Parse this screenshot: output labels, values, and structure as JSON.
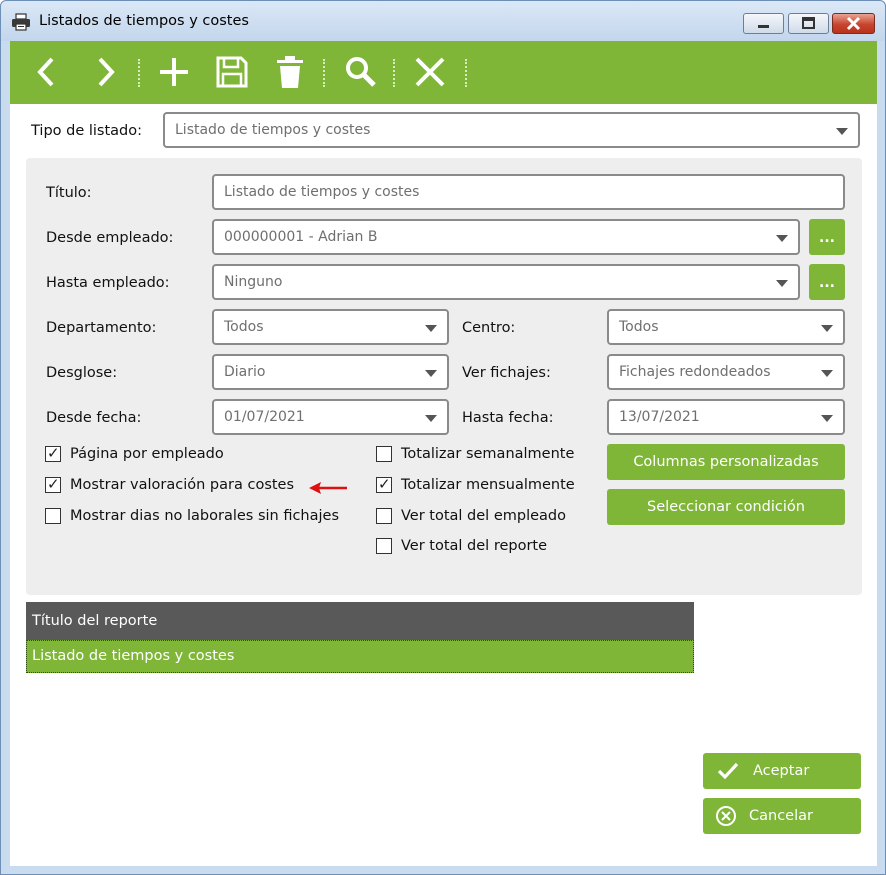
{
  "window": {
    "title": "Listados de tiempos y costes",
    "icon": "printer-icon",
    "controls": [
      "minimize-icon",
      "maximize-icon",
      "close-icon"
    ]
  },
  "colors": {
    "accent_green": "#7fb637",
    "report_header": "#595959",
    "arrow_red": "#e01010"
  },
  "toolbar": {
    "buttons": [
      {
        "name": "previous",
        "icon": "chevron-left-icon"
      },
      {
        "name": "next",
        "icon": "chevron-right-icon"
      },
      {
        "name": "add",
        "icon": "plus-icon"
      },
      {
        "name": "save",
        "icon": "floppy-disk-icon"
      },
      {
        "name": "delete",
        "icon": "trash-icon"
      },
      {
        "name": "search",
        "icon": "magnifier-icon"
      },
      {
        "name": "close",
        "icon": "x-icon"
      }
    ]
  },
  "tipo_listado": {
    "label": "Tipo de listado:",
    "value": "Listado de tiempos y costes"
  },
  "form": {
    "titulo": {
      "label": "Título:",
      "value": "Listado de tiempos y costes"
    },
    "desde_empleado": {
      "label": "Desde empleado:",
      "value": "000000001 - Adrian B",
      "button": "..."
    },
    "hasta_empleado": {
      "label": "Hasta empleado:",
      "value": "Ninguno",
      "button": "..."
    },
    "departamento": {
      "label": "Departamento:",
      "value": "Todos"
    },
    "centro": {
      "label": "Centro:",
      "value": "Todos"
    },
    "desglose": {
      "label": "Desglose:",
      "value": "Diario"
    },
    "ver_fichajes": {
      "label": "Ver fichajes:",
      "value": "Fichajes redondeados"
    },
    "desde_fecha": {
      "label": "Desde fecha:",
      "value": "01/07/2021"
    },
    "hasta_fecha": {
      "label": "Hasta fecha:",
      "value": "13/07/2021"
    }
  },
  "checkboxes_left": [
    {
      "label": "Página por empleado",
      "checked": true
    },
    {
      "label": "Mostrar valoración para costes",
      "checked": true
    },
    {
      "label": "Mostrar dias no laborales sin fichajes",
      "checked": false
    }
  ],
  "checkboxes_right": [
    {
      "label": "Totalizar semanalmente",
      "checked": false
    },
    {
      "label": "Totalizar mensualmente",
      "checked": true
    },
    {
      "label": "Ver total del empleado",
      "checked": false
    },
    {
      "label": "Ver total del reporte",
      "checked": false
    }
  ],
  "check_mark": "✓",
  "buttons": {
    "columnas": "Columnas personalizadas",
    "condicion": "Seleccionar condición",
    "aceptar": "Aceptar",
    "cancelar": "Cancelar"
  },
  "report_table": {
    "header": "Título del reporte",
    "rows": [
      "Listado de tiempos y costes"
    ]
  }
}
